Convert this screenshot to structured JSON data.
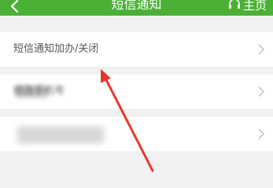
{
  "header": {
    "title": "短信通知",
    "home_label": "主页",
    "bg_color": "#4ab136",
    "back_icon": "chevron-left-icon",
    "home_icon": "headset-icon"
  },
  "menu": {
    "items": [
      {
        "label": "短信通知加办/关闭",
        "icon": "chevron-right-icon"
      },
      {
        "label": "修改手机号",
        "icon": "chevron-right-icon"
      },
      {
        "label": "",
        "icon": "chevron-right-icon"
      }
    ]
  },
  "annotation": {
    "color": "#e8362f",
    "icon": "red-arrow-annotation"
  }
}
